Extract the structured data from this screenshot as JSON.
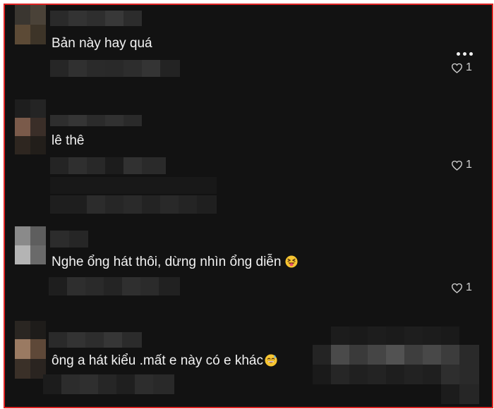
{
  "comments": [
    {
      "text": "Bản này hay quá",
      "like_count": "1"
    },
    {
      "text": "lê thê",
      "like_count": "1"
    },
    {
      "text": "Nghe ổng hát thôi, dừng nhìn ổng diễn",
      "like_count": "1"
    },
    {
      "text": "ông a hát kiểu .mất e này có e khác",
      "like_count": ""
    }
  ],
  "icons": {
    "more": "more-options-icon",
    "like": "heart-outline-icon",
    "emoji_laugh": "squinting-face-with-tongue-icon",
    "emoji_sweat": "grinning-face-with-sweat-icon"
  },
  "colors": {
    "background": "#121212",
    "text": "#f2f2f2",
    "border": "#e02424"
  }
}
